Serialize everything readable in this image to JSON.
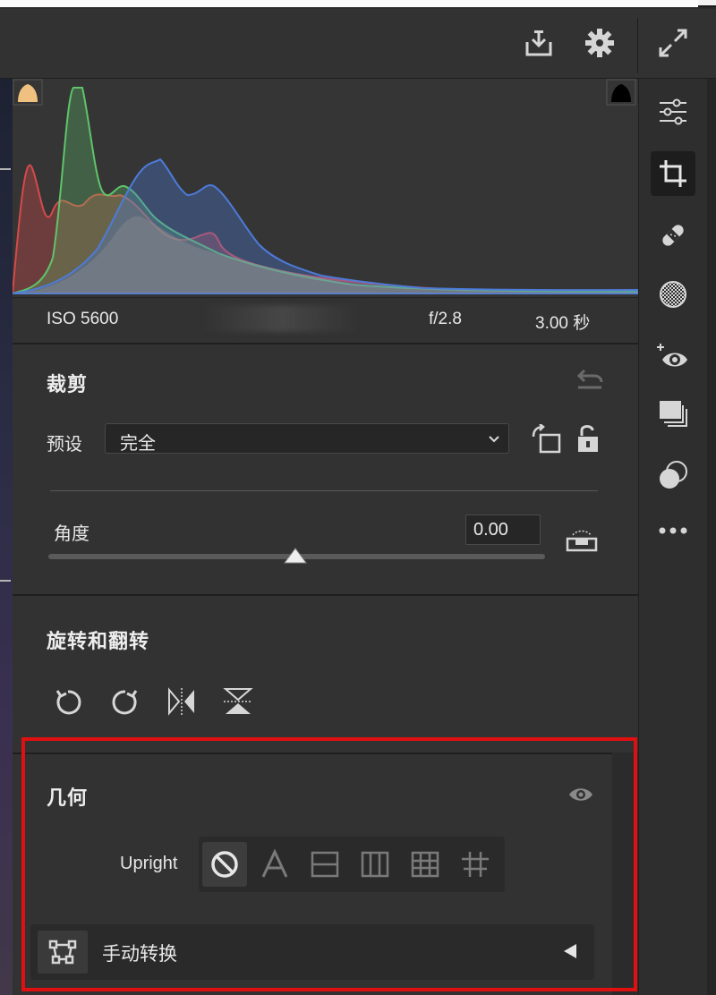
{
  "toolbar": {
    "icons": [
      "save-icon",
      "gear-icon",
      "expand-icon"
    ]
  },
  "histogram": {
    "clipping_left": "shadow-clipping-warning",
    "clipping_right": "highlight-clipping-warning"
  },
  "exif": {
    "iso": "ISO 5600",
    "aperture": "f/2.8",
    "shutter": "3.00 秒"
  },
  "crop": {
    "title": "裁剪",
    "preset_label": "预设",
    "preset_value": "完全",
    "angle_label": "角度",
    "angle_value": "0.00",
    "angle_slider_position": 0.5
  },
  "rotate": {
    "title": "旋转和翻转"
  },
  "geometry": {
    "title": "几何",
    "upright_label": "Upright",
    "upright_options": [
      "off",
      "auto",
      "level",
      "vertical",
      "full",
      "guided"
    ],
    "upright_selected": "off",
    "manual_label": "手动转换"
  },
  "rail": {
    "tools": [
      "edit-icon",
      "crop-icon",
      "heal-icon",
      "mask-icon",
      "redeye-icon",
      "presets-icon",
      "snapshots-icon",
      "more-icon"
    ],
    "active": "crop-icon"
  },
  "colors": {
    "highlight_box": "#e01010",
    "panel_bg": "#323232",
    "histogram_red": "#d64a4a",
    "histogram_green": "#5fc46a",
    "histogram_blue": "#4d7bd9"
  }
}
